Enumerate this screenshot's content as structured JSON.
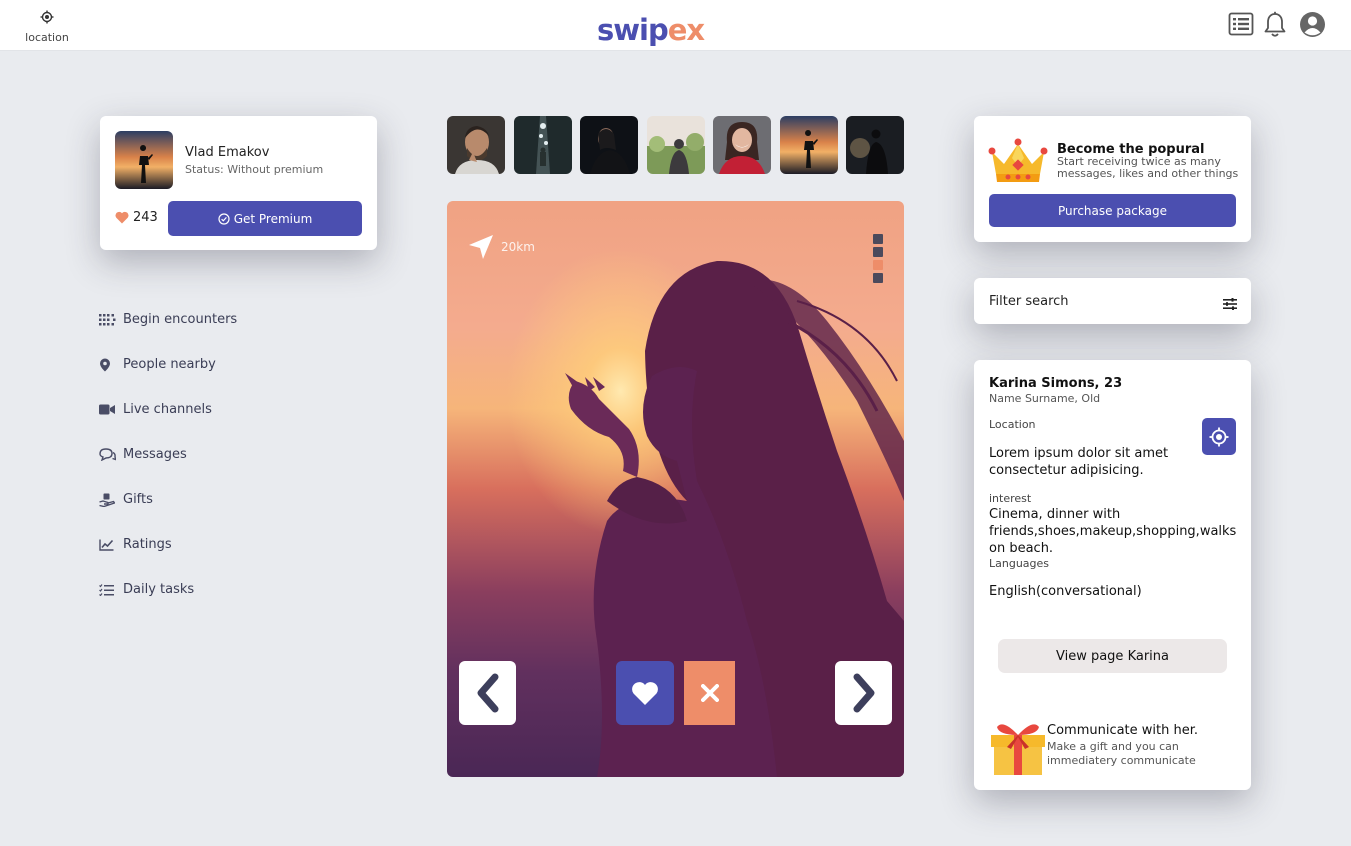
{
  "header": {
    "location_label": "location",
    "logo_part1": "swip",
    "logo_part2": "ex"
  },
  "profile": {
    "name": "Vlad Emakov",
    "status": "Status: Without premium",
    "likes": "243",
    "premium_label": "Get Premium"
  },
  "nav": {
    "items": [
      {
        "label": "Begin encounters",
        "icon": "grid-icon"
      },
      {
        "label": "People nearby",
        "icon": "map-pin-icon"
      },
      {
        "label": "Live channels",
        "icon": "video-camera-icon"
      },
      {
        "label": "Messages",
        "icon": "chat-bubbles-icon"
      },
      {
        "label": "Gifts",
        "icon": "hand-gift-icon"
      },
      {
        "label": "Ratings",
        "icon": "chart-line-icon"
      },
      {
        "label": "Daily tasks",
        "icon": "checklist-icon"
      }
    ]
  },
  "photo": {
    "distance": "20km",
    "page_indicator": {
      "total": 4,
      "active": 3
    }
  },
  "popular": {
    "title": "Become the popural",
    "subtitle": "Start receiving twice as many messages, likes and other things",
    "button": "Purchase package"
  },
  "filter": {
    "label": "Filter search"
  },
  "details": {
    "name": "Karina Simons, 23",
    "sub": "Name Surname, Old",
    "location_label": "Location",
    "location_text": "Lorem ipsum dolor sit amet consectetur adipisicing.",
    "interest_label": "interest",
    "interest_text": "Cinema, dinner with friends,shoes,makeup,shopping,walks on beach.",
    "languages_label": "Languages",
    "languages_text": "English(conversational)",
    "view_button": "View page Karina",
    "gift_title": "Communicate with her.",
    "gift_sub": "Make a gift and you can immediatery communicate"
  },
  "colors": {
    "accent": "#4b4fb0",
    "secondary": "#ee8d69",
    "background": "#e9ebef"
  }
}
